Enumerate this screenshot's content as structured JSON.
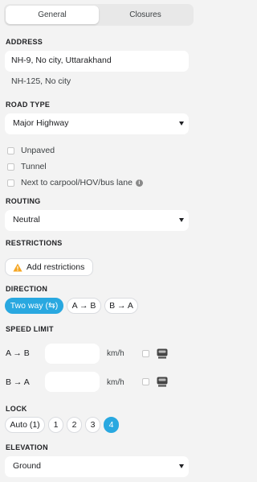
{
  "tabs": [
    {
      "label": "General",
      "active": true
    },
    {
      "label": "Closures",
      "active": false
    }
  ],
  "address": {
    "label": "ADDRESS",
    "primary": "NH-9, No city, Uttarakhand",
    "alternate": "NH-125, No city"
  },
  "road_type": {
    "label": "ROAD TYPE",
    "selected": "Major Highway",
    "options": [
      {
        "label": "Unpaved",
        "checked": false
      },
      {
        "label": "Tunnel",
        "checked": false
      },
      {
        "label": "Next to carpool/HOV/bus lane",
        "checked": false,
        "info_icon": "info-icon"
      }
    ]
  },
  "routing": {
    "label": "ROUTING",
    "selected": "Neutral"
  },
  "restrictions": {
    "label": "RESTRICTIONS",
    "button_label": "Add restrictions",
    "icon": "warning-icon"
  },
  "direction": {
    "label": "DIRECTION",
    "options": [
      {
        "label": "Two way (⇆)",
        "active": true
      },
      {
        "label": "A → B",
        "active": false
      },
      {
        "label": "B → A",
        "active": false
      }
    ]
  },
  "speed_limit": {
    "label": "SPEED LIMIT",
    "rows": [
      {
        "direction": "A → B",
        "value": "",
        "unit": "km/h",
        "verified": false,
        "icon": "speed-camera-icon"
      },
      {
        "direction": "B → A",
        "value": "",
        "unit": "km/h",
        "verified": false,
        "icon": "speed-camera-icon"
      }
    ]
  },
  "lock": {
    "label": "LOCK",
    "options": [
      {
        "label": "Auto (1)",
        "active": false
      },
      {
        "label": "1",
        "active": false
      },
      {
        "label": "2",
        "active": false
      },
      {
        "label": "3",
        "active": false
      },
      {
        "label": "4",
        "active": true
      }
    ]
  },
  "elevation": {
    "label": "ELEVATION",
    "selected": "Ground"
  },
  "colors": {
    "accent": "#29a8e0",
    "background": "#f3f3f3",
    "warning": "#f5a623"
  }
}
